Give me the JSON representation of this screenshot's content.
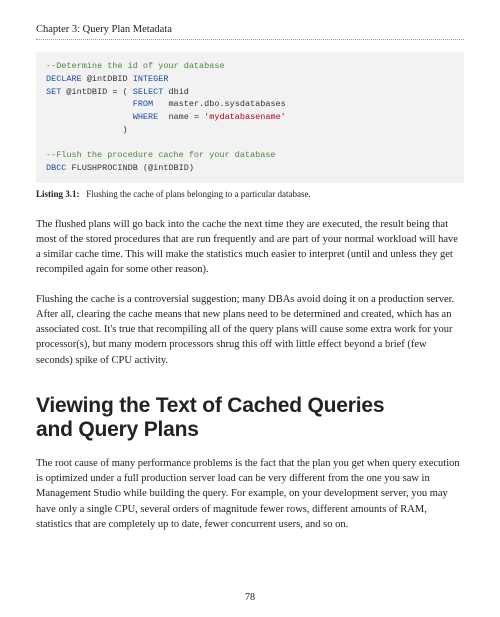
{
  "chapter": "Chapter 3: Query Plan Metadata",
  "code": {
    "c1": "--Determine the id of your database",
    "l2a": "DECLARE",
    "l2b": "@intDBID",
    "l2c": "INTEGER",
    "l3a": "SET",
    "l3b": "@intDBID",
    "l3c": "=",
    "l3d": "(",
    "l3e": "SELECT",
    "l3f": "dbid",
    "l4a": "FROM",
    "l4b": "master.dbo.sysdatabases",
    "l5a": "WHERE",
    "l5b": "name",
    "l5c": "=",
    "l5d": "'mydatabasename'",
    "l6a": ")",
    "c2": "--Flush the procedure cache for your database",
    "l8a": "DBCC",
    "l8b": "FLUSHPROCINDB",
    "l8c": "(",
    "l8d": "@intDBID",
    "l8e": ")"
  },
  "listing": {
    "label": "Listing 3.1:",
    "text": "Flushing the cache of plans belonging to a particular database."
  },
  "para1": "The flushed plans will go back into the cache the next time they are executed, the result being that most of the stored procedures that are run frequently and are part of your normal workload will have a similar cache time. This will make the statistics much easier to interpret (until and unless they get recompiled again for some other reason).",
  "para2": "Flushing the cache is a controversial suggestion; many DBAs avoid doing it on a production server. After all, clearing the cache means that new plans need to be determined and created, which has an associated cost. It's true that recompiling all of the query plans will cause some extra work for your processor(s), but many modern processors shrug this off with little effect beyond a brief (few seconds) spike of CPU activity.",
  "heading_line1": "Viewing the Text of Cached Queries",
  "heading_line2": "and Query Plans",
  "para3": "The root cause of many performance problems is the fact that the plan you get when query execution is optimized under a full production server load can be very different from the one you saw in Management Studio while building the query. For example, on your development server, you may have only a single CPU, several orders of magnitude fewer rows, different amounts of RAM, statistics that are completely up to date, fewer concurrent users, and so on.",
  "page_number": "78"
}
